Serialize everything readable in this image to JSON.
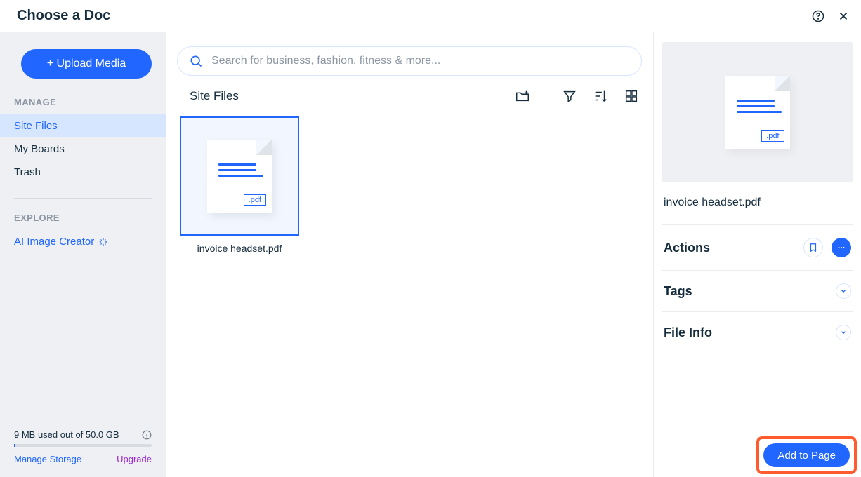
{
  "header": {
    "title": "Choose a Doc"
  },
  "sidebar": {
    "upload_label": "+ Upload Media",
    "manage_label": "MANAGE",
    "nav": {
      "site_files": "Site Files",
      "my_boards": "My Boards",
      "trash": "Trash"
    },
    "explore_label": "EXPLORE",
    "ai_creator": "AI Image Creator",
    "storage": {
      "text": "9 MB used out of 50.0 GB",
      "manage": "Manage Storage",
      "upgrade": "Upgrade"
    }
  },
  "search": {
    "placeholder": "Search for business, fashion, fitness & more..."
  },
  "toolbar": {
    "breadcrumb": "Site Files"
  },
  "file": {
    "name": "invoice headset.pdf",
    "ext": ".pdf"
  },
  "panel": {
    "filename": "invoice headset.pdf",
    "ext": ".pdf",
    "actions": "Actions",
    "tags": "Tags",
    "file_info": "File Info",
    "add_to_page": "Add to Page"
  }
}
